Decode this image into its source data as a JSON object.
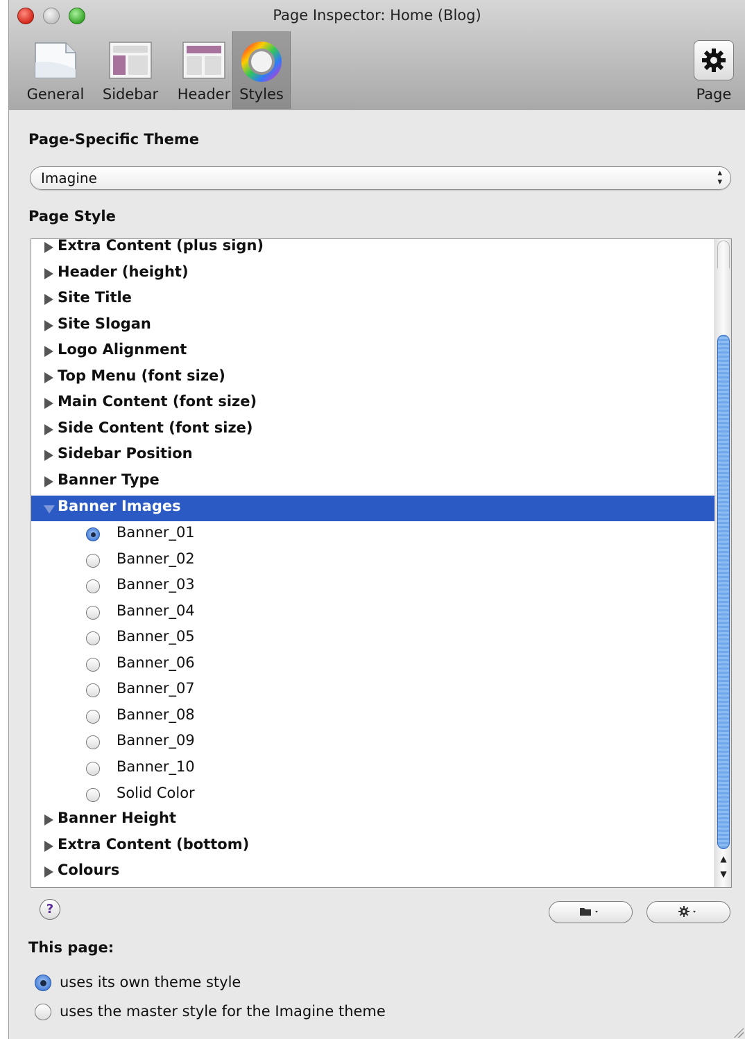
{
  "window": {
    "title": "Page Inspector: Home (Blog)"
  },
  "toolbar": {
    "tabs": [
      {
        "label": "General",
        "icon": "general-page-icon",
        "selected": false
      },
      {
        "label": "Sidebar",
        "icon": "sidebar-layout-icon",
        "selected": false
      },
      {
        "label": "Header",
        "icon": "header-layout-icon",
        "selected": false
      },
      {
        "label": "Styles",
        "icon": "color-wheel-icon",
        "selected": true
      }
    ],
    "right_button": {
      "label": "Page",
      "icon": "gear-icon"
    }
  },
  "theme": {
    "heading": "Page-Specific Theme",
    "selected": "Imagine"
  },
  "page_style": {
    "heading": "Page Style",
    "groups_before": [
      "Extra Content (plus sign)",
      "Header (height)",
      "Site Title",
      "Site Slogan",
      "Logo Alignment",
      "Top Menu (font size)",
      "Main Content (font size)",
      "Side Content (font size)",
      "Sidebar Position",
      "Banner Type"
    ],
    "expanded_group": "Banner Images",
    "expanded_options": [
      "Banner_01",
      "Banner_02",
      "Banner_03",
      "Banner_04",
      "Banner_05",
      "Banner_06",
      "Banner_07",
      "Banner_08",
      "Banner_09",
      "Banner_10",
      "Solid Color"
    ],
    "selected_option": "Banner_01",
    "groups_after": [
      "Banner Height",
      "Extra Content (bottom)",
      "Colours"
    ]
  },
  "footer": {
    "help_label": "?",
    "this_page_heading": "This page:",
    "options": [
      {
        "label": "uses its own theme style",
        "selected": true
      },
      {
        "label": "uses the master style for the Imagine theme",
        "selected": false
      }
    ]
  },
  "colors": {
    "selection": "#2b5ac5",
    "scroll_thumb": "#6fa7ea"
  }
}
